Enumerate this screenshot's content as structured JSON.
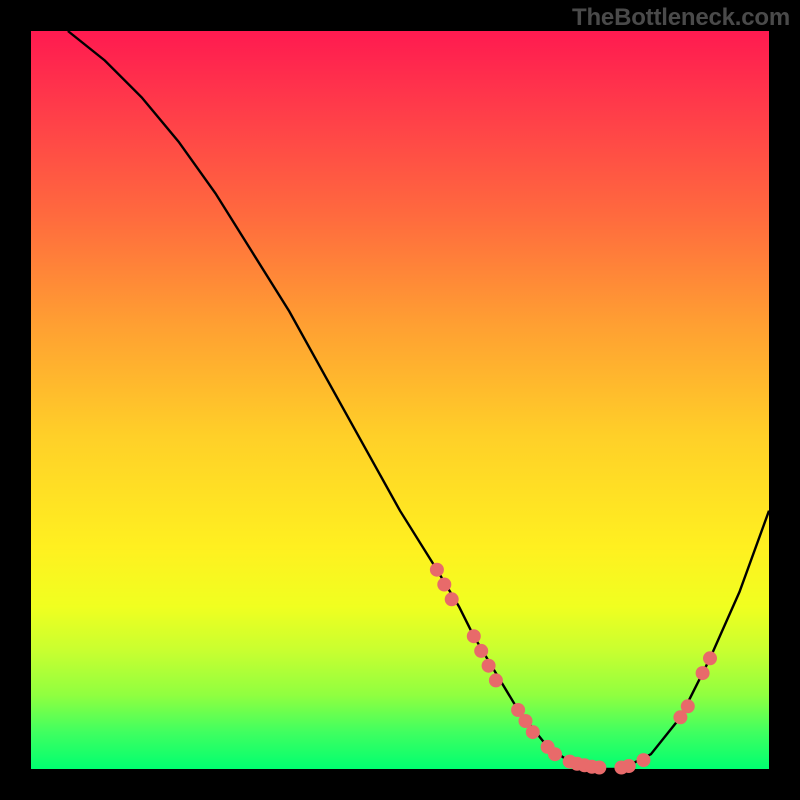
{
  "watermark": "TheBottleneck.com",
  "colors": {
    "gradient_top": "#ff1a50",
    "gradient_mid": "#ffd028",
    "gradient_bottom": "#00ff70",
    "curve": "#000000",
    "marker": "#e86a6a",
    "frame": "#000000"
  },
  "chart_data": {
    "type": "line",
    "title": "",
    "xlabel": "",
    "ylabel": "",
    "xlim": [
      0,
      100
    ],
    "ylim": [
      0,
      100
    ],
    "series": [
      {
        "name": "bottleneck-curve",
        "x": [
          5,
          10,
          15,
          20,
          25,
          30,
          35,
          40,
          45,
          50,
          55,
          58,
          60,
          63,
          66,
          70,
          73,
          76,
          80,
          84,
          88,
          92,
          96,
          100
        ],
        "values": [
          100,
          96,
          91,
          85,
          78,
          70,
          62,
          53,
          44,
          35,
          27,
          22,
          18,
          13,
          8,
          3,
          1,
          0,
          0,
          2,
          7,
          15,
          24,
          35
        ]
      }
    ],
    "markers": [
      {
        "x": 55,
        "y": 27
      },
      {
        "x": 56,
        "y": 25
      },
      {
        "x": 57,
        "y": 23
      },
      {
        "x": 60,
        "y": 18
      },
      {
        "x": 61,
        "y": 16
      },
      {
        "x": 62,
        "y": 14
      },
      {
        "x": 63,
        "y": 12
      },
      {
        "x": 66,
        "y": 8
      },
      {
        "x": 67,
        "y": 6.5
      },
      {
        "x": 68,
        "y": 5
      },
      {
        "x": 70,
        "y": 3
      },
      {
        "x": 71,
        "y": 2
      },
      {
        "x": 73,
        "y": 1
      },
      {
        "x": 74,
        "y": 0.7
      },
      {
        "x": 75,
        "y": 0.5
      },
      {
        "x": 76,
        "y": 0.3
      },
      {
        "x": 77,
        "y": 0.2
      },
      {
        "x": 80,
        "y": 0.2
      },
      {
        "x": 81,
        "y": 0.4
      },
      {
        "x": 83,
        "y": 1.2
      },
      {
        "x": 88,
        "y": 7
      },
      {
        "x": 89,
        "y": 8.5
      },
      {
        "x": 91,
        "y": 13
      },
      {
        "x": 92,
        "y": 15
      }
    ]
  }
}
